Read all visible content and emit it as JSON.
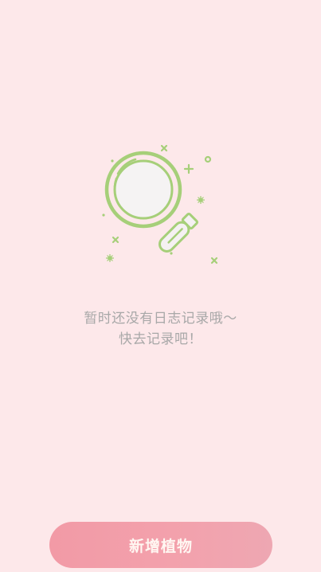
{
  "empty_state": {
    "icon": "magnifier-icon",
    "message_line1": "暂时还没有日志记录哦～",
    "message_line2": "快去记录吧！"
  },
  "actions": {
    "add_plant_label": "新增植物"
  },
  "colors": {
    "background": "#fde8ea",
    "accent_green": "#a6cf79",
    "button_pink": "#f29aa6",
    "text_gray": "#a8a8a8"
  }
}
